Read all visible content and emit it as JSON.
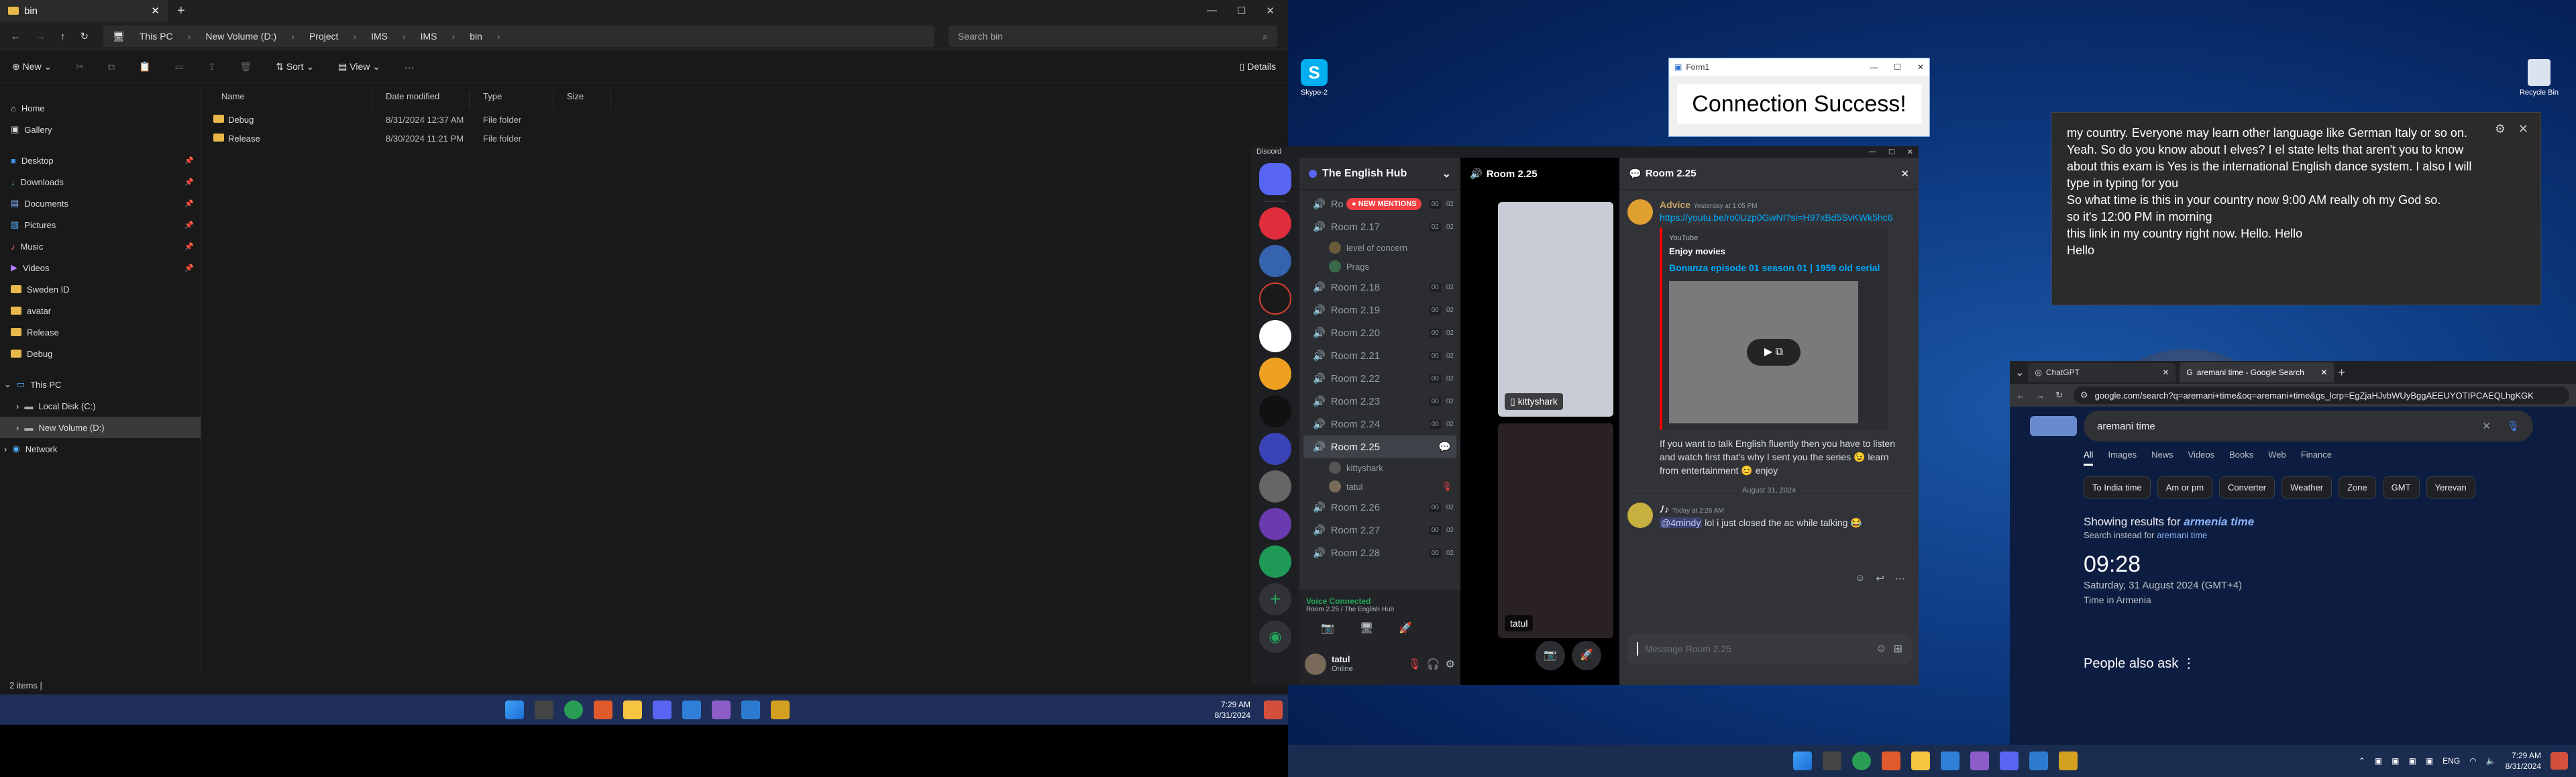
{
  "explorer": {
    "tab_title": "bin",
    "address": {
      "segments": [
        "This PC",
        "New Volume (D:)",
        "Project",
        "IMS",
        "IMS",
        "bin"
      ]
    },
    "search_placeholder": "Search bin",
    "commands": {
      "new": "New",
      "sort": "Sort",
      "view": "View",
      "more": "···",
      "details": "Details"
    },
    "nav": [
      {
        "label": "Home"
      },
      {
        "label": "Gallery"
      },
      {
        "label": "Desktop"
      },
      {
        "label": "Downloads"
      },
      {
        "label": "Documents"
      },
      {
        "label": "Pictures"
      },
      {
        "label": "Music"
      },
      {
        "label": "Videos"
      },
      {
        "label": "Sweden ID"
      },
      {
        "label": "avatar"
      },
      {
        "label": "Release"
      },
      {
        "label": "Debug"
      },
      {
        "label": "This PC"
      },
      {
        "label": "Local Disk (C:)"
      },
      {
        "label": "New Volume (D:)"
      },
      {
        "label": "Network"
      }
    ],
    "columns": [
      "Name",
      "Date modified",
      "Type",
      "Size"
    ],
    "files": [
      {
        "name": "Debug",
        "date": "8/31/2024 12:37 AM",
        "type": "File folder",
        "size": ""
      },
      {
        "name": "Release",
        "date": "8/30/2024 11:21 PM",
        "type": "File folder",
        "size": ""
      }
    ],
    "status": "2 items",
    "taskbar_time": "7:29 AM",
    "taskbar_date": "8/31/2024"
  },
  "desktop": {
    "icons": [
      {
        "label": "Skype-2"
      },
      {
        "label": "Recycle Bin"
      }
    ]
  },
  "form": {
    "title": "Form1",
    "message": "Connection Success!"
  },
  "notification": {
    "lines": [
      "my country. Everyone may learn other language like German Italy or so on. Yeah. So do you know about I elves? I el state lelts that aren't you to know about this exam is Yes is the international English dance system. I also I will type in typing for you",
      "So what time is this in your country now 9:00 AM really oh my God so.",
      "so it's 12:00 PM in morning",
      "this link in my country right now. Hello. Hello",
      "Hello"
    ]
  },
  "discord": {
    "app_label": "Discord",
    "server_name": "The English Hub",
    "new_mentions": "NEW MENTIONS",
    "channels": [
      {
        "name": "Ro",
        "count": "00",
        "limit": "02"
      },
      {
        "name": "Room 2.17",
        "count": "02",
        "limit": "02"
      },
      {
        "name": "level of concern",
        "user": true
      },
      {
        "name": "Prags",
        "user": true
      },
      {
        "name": "Room 2.18",
        "count": "00",
        "limit": "02"
      },
      {
        "name": "Room 2.19",
        "count": "00",
        "limit": "02"
      },
      {
        "name": "Room 2.20",
        "count": "00",
        "limit": "02"
      },
      {
        "name": "Room 2.21",
        "count": "00",
        "limit": "02"
      },
      {
        "name": "Room 2.22",
        "count": "00",
        "limit": "02"
      },
      {
        "name": "Room 2.23",
        "count": "00",
        "limit": "02"
      },
      {
        "name": "Room 2.24",
        "count": "00",
        "limit": "02"
      },
      {
        "name": "Room 2.25",
        "count": "",
        "limit": "",
        "active": true
      },
      {
        "name": "kittyshark",
        "user": true
      },
      {
        "name": "tatul",
        "user": true
      },
      {
        "name": "Room 2.26",
        "count": "00",
        "limit": "02"
      },
      {
        "name": "Room 2.27",
        "count": "00",
        "limit": "02"
      },
      {
        "name": "Room 2.28",
        "count": "00",
        "limit": "02"
      }
    ],
    "voice_status": "Voice Connected",
    "voice_location": "Room 2.25 / The English Hub",
    "user": {
      "name": "tatul",
      "status": "Online"
    },
    "voice_room_title": "Room 2.25",
    "tiles": [
      {
        "name": "kittyshark"
      },
      {
        "name": "tatul"
      }
    ],
    "chat_title": "Room 2.25",
    "messages": [
      {
        "author": "Advice",
        "time": "Yesterday at 1:05 PM",
        "link": "https://youtu.be/ro0Uzp0GwNI?si=H97xBd5SvKWk5hc6",
        "embed": {
          "provider": "YouTube",
          "author": "Enjoy movies",
          "title": "Bonanza episode 01 season 01 | 1959 old serial"
        },
        "text": "If you want to talk English fluently then you have to listen and watch first that's why I sent you the series 😉 learn from entertainment 😊 enjoy"
      },
      {
        "author": "ﾉ♪",
        "time": "Today at 2:26 AM",
        "mention": "@4mindy",
        "text": "lol i just closed the ac while talking 😂"
      }
    ],
    "divider": "August 31, 2024",
    "input_placeholder": "Message Room 2.25"
  },
  "chrome": {
    "tabs": [
      {
        "title": "ChatGPT"
      },
      {
        "title": "aremani time - Google Search"
      }
    ],
    "url": "google.com/search?q=aremani+time&oq=aremani+time&gs_lcrp=EgZjaHJvbWUyBggAEEUYOTIPCAEQLhgKGK",
    "query": "aremani time",
    "search_tabs": [
      "All",
      "Images",
      "News",
      "Videos",
      "Books",
      "Web",
      "Finance"
    ],
    "chips": [
      "To India time",
      "Am or pm",
      "Converter",
      "Weather",
      "Zone",
      "GMT",
      "Yerevan"
    ],
    "showing_prefix": "Showing results for ",
    "showing_query": "armenia time",
    "instead_prefix": "Search instead for ",
    "instead_query": "aremani time",
    "time": "09:28",
    "date": "Saturday, 31 August 2024 (GMT+4)",
    "place": "Time in Armenia",
    "people_also_ask": "People also ask"
  },
  "win11_taskbar": {
    "lang": "ENG",
    "time": "7:29 AM",
    "date": "8/31/2024"
  }
}
